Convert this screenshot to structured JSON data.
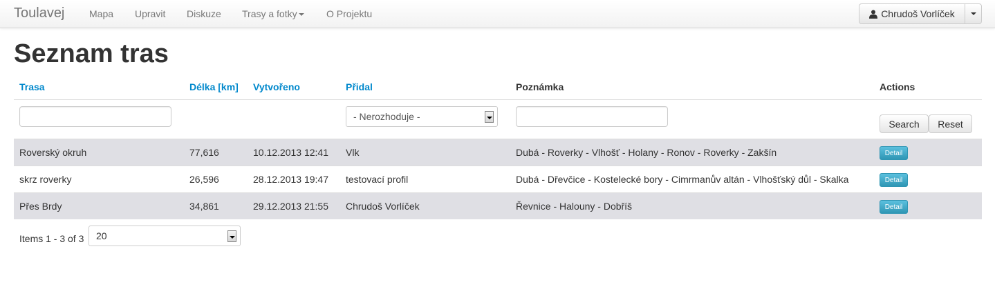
{
  "navbar": {
    "brand": "Toulavej",
    "items": [
      {
        "label": "Mapa"
      },
      {
        "label": "Upravit"
      },
      {
        "label": "Diskuze"
      },
      {
        "label": "Trasy a fotky"
      },
      {
        "label": "O Projektu"
      }
    ],
    "user": {
      "name": "Chrudoš Vorlíček",
      "icon": "user-icon"
    }
  },
  "page": {
    "title": "Seznam tras"
  },
  "table": {
    "headers": {
      "trasa": "Trasa",
      "delka": "Délka [km]",
      "vytvoreno": "Vytvořeno",
      "pridal": "Přidal",
      "poznamka": "Poznámka",
      "actions": "Actions"
    },
    "filters": {
      "trasa_value": "",
      "pridal_selected": "- Nerozhoduje -",
      "poznamka_value": "",
      "search_label": "Search",
      "reset_label": "Reset"
    },
    "rows": [
      {
        "trasa": "Roverský okruh",
        "delka": "77,616",
        "vytvoreno": "10.12.2013 12:41",
        "pridal": "Vlk",
        "poznamka": "Dubá - Roverky - Vlhošť - Holany - Ronov - Roverky - Zakšín",
        "action": "Detail"
      },
      {
        "trasa": "skrz roverky",
        "delka": "26,596",
        "vytvoreno": "28.12.2013 19:47",
        "pridal": "testovací profil",
        "poznamka": "Dubá - Dřevčice - Kostelecké bory - Cimrmanův altán - Vlhošťský důl - Skalka",
        "action": "Detail"
      },
      {
        "trasa": "Přes Brdy",
        "delka": "34,861",
        "vytvoreno": "29.12.2013 21:55",
        "pridal": "Chrudoš Vorlíček",
        "poznamka": "Řevnice - Halouny - Dobříš",
        "action": "Detail"
      }
    ]
  },
  "pager": {
    "label": "Items 1 - 3 of 3",
    "page_size": "20"
  },
  "colors": {
    "link": "#0088cc",
    "info_button": "#2f96b4",
    "striped_row": "#dfdfe4"
  }
}
